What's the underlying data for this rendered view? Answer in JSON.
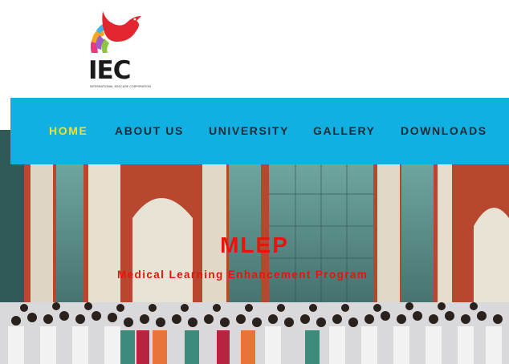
{
  "brand": {
    "logo_text": "IEC",
    "logo_subtext": "INTERNATIONAL EDUCARE CORPORATION",
    "colors": {
      "bird_red": "#e2262d",
      "text": "#1b1b1b"
    }
  },
  "nav": {
    "items": [
      {
        "label": "HOME",
        "active": true
      },
      {
        "label": "ABOUT US",
        "active": false
      },
      {
        "label": "UNIVERSITY",
        "active": false
      },
      {
        "label": "GALLERY",
        "active": false
      },
      {
        "label": "DOWNLOADS",
        "active": false
      }
    ],
    "colors": {
      "background": "#10b0e2",
      "active_text": "#f5e21d",
      "text": "#1a2a33"
    }
  },
  "hero": {
    "title": "MLEP",
    "subtitle": "Medical Learning Enhancement Program",
    "colors": {
      "title": "#e8140a"
    }
  }
}
